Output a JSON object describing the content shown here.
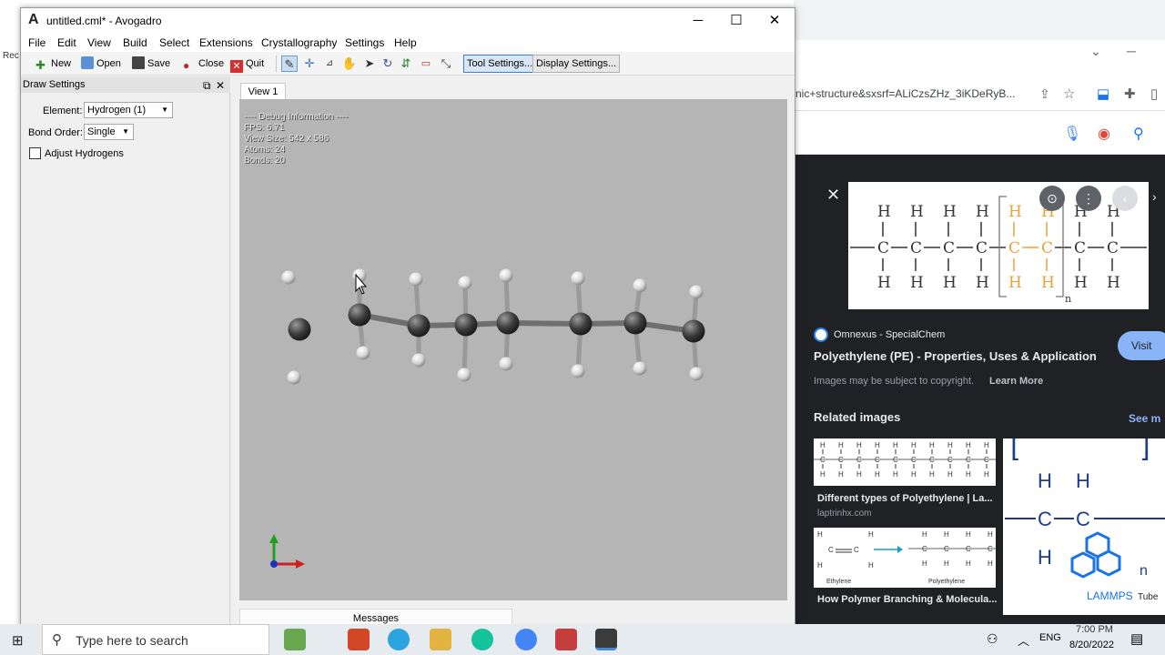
{
  "window": {
    "title": "untitled.cml* - Avogadro",
    "controls": {
      "minimize": "─",
      "maximize": "☐",
      "close": "✕"
    }
  },
  "menu": [
    "File",
    "Edit",
    "View",
    "Build",
    "Select",
    "Extensions",
    "Crystallography",
    "Settings",
    "Help"
  ],
  "toolbar": {
    "new": "New",
    "open": "Open",
    "save": "Save",
    "close": "Close",
    "quit": "Quit",
    "tool_settings": "Tool Settings...",
    "display_settings": "Display Settings..."
  },
  "dock": {
    "title": "Draw Settings",
    "element_label": "Element:",
    "element_value": "Hydrogen (1)",
    "bond_order_label": "Bond Order:",
    "bond_order_value": "Single",
    "adjust_hydrogens_label": "Adjust Hydrogens",
    "adjust_hydrogens_checked": false
  },
  "view": {
    "tab": "View 1",
    "debug": {
      "header": "---- Debug Information ----",
      "fps": "FPS: 6.71",
      "view_size": "View Size: 542 x 586",
      "atoms": "Atoms: 24",
      "bonds": "Bonds: 20"
    }
  },
  "messages_tab": "Messages",
  "browser": {
    "url": "nic+structure&sxsrf=ALiCzsZHz_3iKDeRyB...",
    "source_name": "Omnexus - SpecialChem",
    "result_title": "Polyethylene (PE) - Properties, Uses & Application",
    "visit": "Visit",
    "copyright": "Images may be subject to copyright.",
    "learn_more": "Learn More",
    "related_heading": "Related images",
    "see_more": "See m",
    "related": [
      {
        "title": "Different types of Polyethylene | La...",
        "source": "laptrinhx.com"
      },
      {
        "title": "How Polymer Branching & Molecula..."
      }
    ],
    "diagram_top": {
      "h": "H",
      "c": "C",
      "n": "n"
    },
    "related2_labels": {
      "left": "Ethylene",
      "right": "Polyethylene"
    },
    "lammps": "LAMMPS",
    "tube": "Tube"
  },
  "desktop_edge_text": "Rec",
  "taskbar": {
    "search_placeholder": "Type here to search",
    "language": "ENG",
    "time": "7:00 PM",
    "date": "8/20/2022"
  },
  "colors": {
    "highlight_orange": "#e8a23a",
    "visit_button": "#8ab4f8",
    "link_blue": "#8ab4f8",
    "lammps_blue": "#1a73e8"
  }
}
